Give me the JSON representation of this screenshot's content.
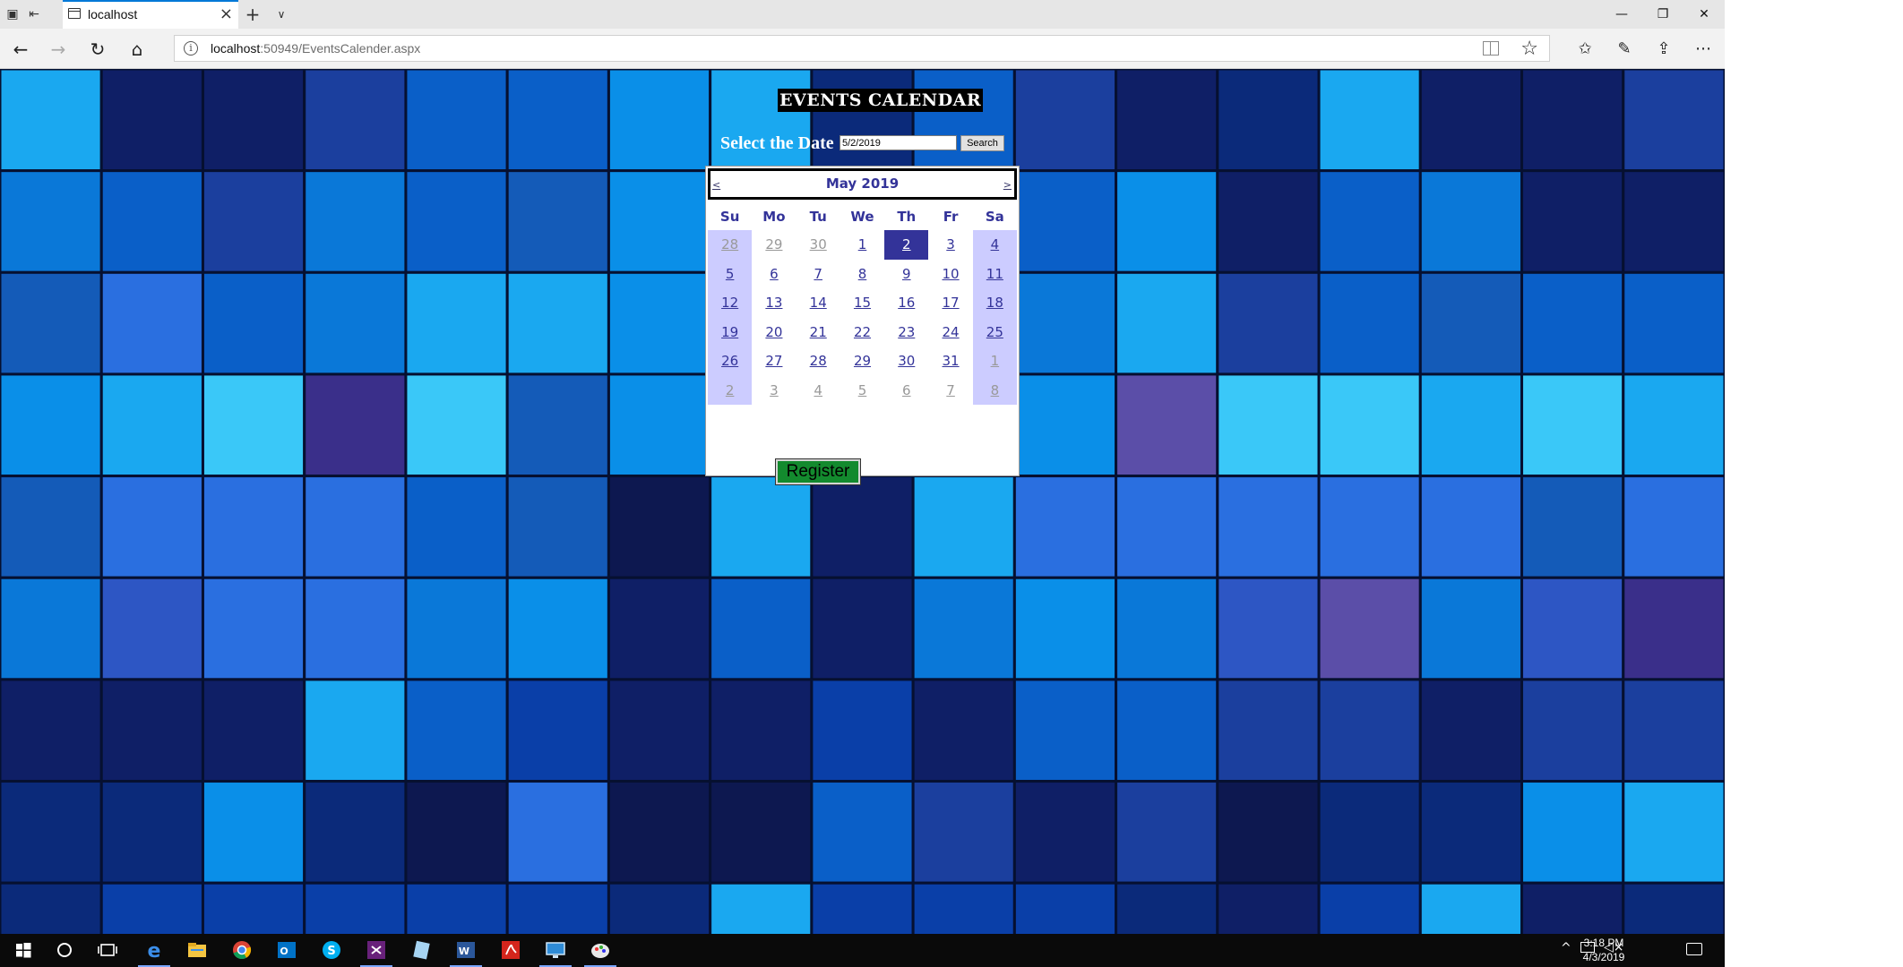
{
  "browser": {
    "tab": {
      "title": "localhost"
    },
    "address": {
      "host": "localhost",
      "path": ":50949/EventsCalender.aspx"
    }
  },
  "page": {
    "heading": "EVENTS CALENDAR",
    "select_label": "Select the Date",
    "date_input_value": "5/2/2019",
    "search_label": "Search",
    "register_label": "Register"
  },
  "calendar": {
    "prev": "<",
    "next": ">",
    "month_title": "May 2019",
    "days_of_week": [
      "Su",
      "Mo",
      "Tu",
      "We",
      "Th",
      "Fr",
      "Sa"
    ],
    "weeks": [
      [
        "28",
        "29",
        "30",
        "1",
        "2",
        "3",
        "4"
      ],
      [
        "5",
        "6",
        "7",
        "8",
        "9",
        "10",
        "11"
      ],
      [
        "12",
        "13",
        "14",
        "15",
        "16",
        "17",
        "18"
      ],
      [
        "19",
        "20",
        "21",
        "22",
        "23",
        "24",
        "25"
      ],
      [
        "26",
        "27",
        "28",
        "29",
        "30",
        "31",
        "1"
      ],
      [
        "2",
        "3",
        "4",
        "5",
        "6",
        "7",
        "8"
      ]
    ],
    "selected_day": "2",
    "colors": {
      "title_text": "#333399",
      "weekend_bg": "#ccccff",
      "selected_bg": "#333399",
      "other_month_text": "#999999"
    }
  },
  "taskbar": {
    "time": "3:18 PM",
    "date": "4/3/2019",
    "apps": [
      "windows-start-icon",
      "cortana-icon",
      "task-view-icon",
      "edge-icon",
      "file-explorer-icon",
      "chrome-icon",
      "outlook-icon",
      "skype-icon",
      "visual-studio-icon",
      "notepad-icon",
      "word-icon",
      "acrobat-icon",
      "remote-desktop-icon",
      "paint-icon"
    ]
  },
  "colors": {
    "register_bg": "#138a2e",
    "accent": "#0078d7"
  }
}
